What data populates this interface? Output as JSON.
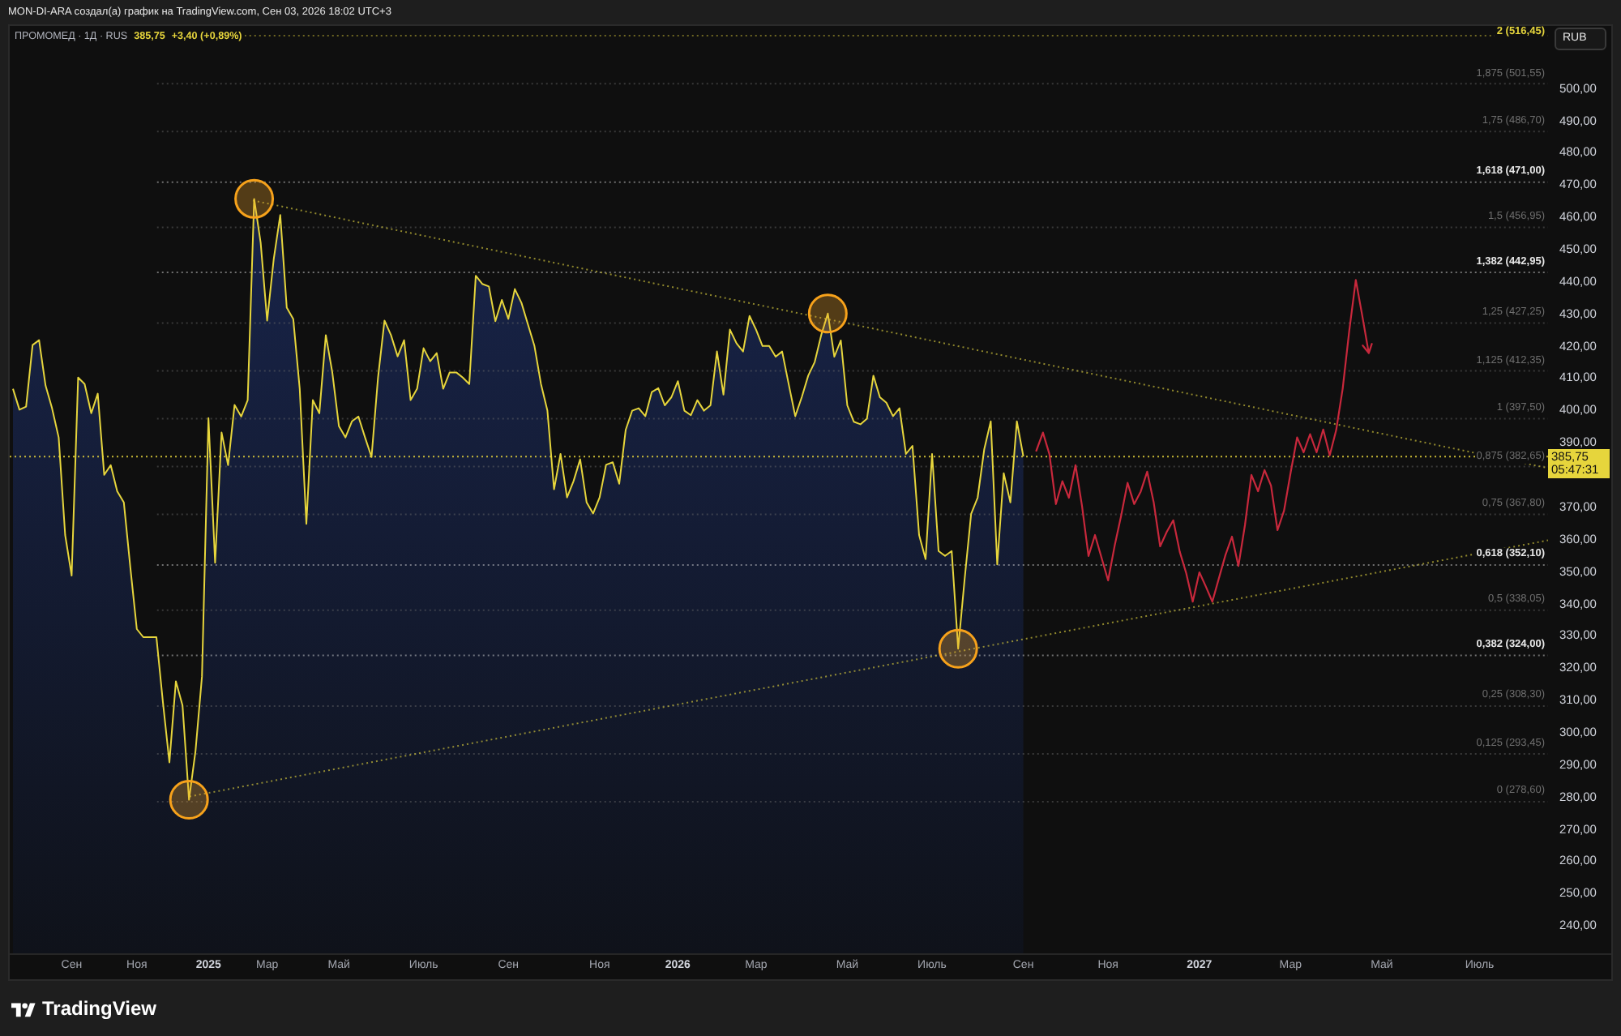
{
  "header": {
    "caption": "MON-DI-ARA создал(а) график на TradingView.com, Сен 03, 2026 18:02 UTC+3"
  },
  "chart": {
    "legend": {
      "symbol": "ПРОМОМЕД · 1Д · RUS",
      "price": "385,75",
      "change": "+3,40 (+0,89%)"
    },
    "currency": "RUB",
    "last_price_badge": {
      "price": "385,75",
      "countdown": "05:47:31"
    },
    "chart_data": {
      "type": "area",
      "categories": [
        null,
        null,
        null,
        null,
        null,
        null,
        null,
        null,
        null,
        "Сен",
        null,
        null,
        null,
        null,
        null,
        null,
        null,
        null,
        null,
        "Ноя",
        null,
        null,
        null,
        null,
        null,
        null,
        null,
        null,
        null,
        null,
        "2025",
        null,
        null,
        null,
        null,
        null,
        null,
        null,
        null,
        "Мар",
        null,
        null,
        null,
        null,
        null,
        null,
        null,
        null,
        null,
        null,
        "Май",
        null,
        null,
        null,
        null,
        null,
        null,
        null,
        null,
        null,
        null,
        null,
        null,
        "Июль",
        null,
        null,
        null,
        null,
        null,
        null,
        null,
        null,
        null,
        null,
        null,
        null,
        "Сен",
        null,
        null,
        null,
        null,
        null,
        null,
        null,
        null,
        null,
        null,
        null,
        null,
        null,
        "Ноя",
        null,
        null,
        null,
        null,
        null,
        null,
        null,
        null,
        null,
        null,
        null,
        "2026",
        null,
        null,
        null,
        null,
        null,
        null,
        null,
        null,
        null,
        null,
        null,
        "Мар",
        null,
        null,
        null,
        null,
        null,
        null,
        null,
        null,
        null,
        null,
        null,
        null,
        null,
        "Май",
        null,
        null,
        null,
        null,
        null,
        null,
        null,
        null,
        null,
        null,
        null,
        null,
        "Июль",
        null,
        null,
        null,
        null,
        null,
        null,
        null,
        null,
        null,
        null,
        null,
        null,
        null,
        "Сен",
        null,
        null,
        null,
        null,
        null,
        null,
        null,
        null,
        null,
        null,
        null,
        null,
        "Ноя",
        null,
        null,
        null,
        null,
        null,
        null,
        null,
        null,
        null,
        null,
        null,
        null,
        null,
        "2027",
        null,
        null,
        null,
        null,
        null,
        null,
        null,
        null,
        null,
        null,
        null,
        null,
        null,
        "Мар",
        null,
        null,
        null,
        null,
        null,
        null,
        null,
        null,
        null,
        null,
        null,
        null,
        null,
        "Май",
        null,
        null,
        null,
        null,
        null,
        null,
        null,
        null,
        null,
        null,
        null,
        null,
        null,
        null,
        "Июль",
        null,
        null,
        null,
        null,
        null,
        null,
        null,
        null,
        null,
        null
      ],
      "series": [
        {
          "color": "#e6d53c",
          "values": [
            406.8,
            400.3,
            401.3,
            420.4,
            421.9,
            407.8,
            400.8,
            391.7,
            361.4,
            348.8,
            410.3,
            408.3,
            399.2,
            405.3,
            380.1,
            383.1,
            375.0,
            371.5,
            351.4,
            332.2,
            329.7,
            329.7,
            329.7,
            309.5,
            290.8,
            316.0,
            308.5,
            279.2,
            294.3,
            317.5,
            397.7,
            352.8,
            393.2,
            383.1,
            401.8,
            398.2,
            403.3,
            465.8,
            452.2,
            428.0,
            447.2,
            460.8,
            432.0,
            428.5,
            406.8,
            364.9,
            403.3,
            399.2,
            423.5,
            411.9,
            395.2,
            391.7,
            396.7,
            398.2,
            391.7,
            385.6,
            410.3,
            428.0,
            423.5,
            416.9,
            421.9,
            403.3,
            406.8,
            419.4,
            415.4,
            417.9,
            406.8,
            411.9,
            411.9,
            410.3,
            408.3,
            441.9,
            439.4,
            438.6,
            427.8,
            434.4,
            428.5,
            437.8,
            433.5,
            426.8,
            420.1,
            408.4,
            400.0,
            375.6,
            386.6,
            373.1,
            378.1,
            384.9,
            371.5,
            368.1,
            373.1,
            383.2,
            384.0,
            377.3,
            394.1,
            400.0,
            400.8,
            398.3,
            405.8,
            407.0,
            401.7,
            404.2,
            409.2,
            400.0,
            398.6,
            403.3,
            400.0,
            401.7,
            418.4,
            405.0,
            425.2,
            420.9,
            418.4,
            429.4,
            425.2,
            420.1,
            420.1,
            416.8,
            418.4,
            408.4,
            398.3,
            404.2,
            410.9,
            415.1,
            423.5,
            430.2,
            416.8,
            421.8,
            401.7,
            396.6,
            395.8,
            397.5,
            410.9,
            404.2,
            402.5,
            398.3,
            400.8,
            386.6,
            389.1,
            361.4,
            353.9,
            386.6,
            356.4,
            354.9,
            356.4,
            326.1,
            347.8,
            368.0,
            373.0,
            388.1,
            396.7,
            352.3,
            380.6,
            371.5,
            396.7,
            385.8,
            null,
            null,
            null,
            null,
            null,
            null,
            null,
            null,
            null,
            null,
            null,
            null,
            null,
            null,
            null,
            null,
            null,
            null,
            null,
            null,
            null,
            null,
            null,
            null,
            null,
            null,
            null,
            null,
            null,
            null,
            null,
            null,
            null,
            null,
            null,
            null,
            null,
            null,
            null,
            null,
            null,
            null,
            null,
            null,
            null,
            null,
            null,
            null,
            null,
            null,
            null,
            null,
            null,
            null,
            null,
            null,
            null,
            null,
            null,
            null,
            null,
            null,
            null,
            null,
            null,
            null,
            null,
            null,
            null,
            null,
            null,
            null,
            null,
            null,
            null,
            null,
            null,
            null,
            null,
            null
          ]
        },
        {
          "type": "line",
          "color": "#c8283c",
          "values": [
            null,
            null,
            null,
            null,
            null,
            null,
            null,
            null,
            null,
            null,
            null,
            null,
            null,
            null,
            null,
            null,
            null,
            null,
            null,
            null,
            null,
            null,
            null,
            null,
            null,
            null,
            null,
            null,
            null,
            null,
            null,
            null,
            null,
            null,
            null,
            null,
            null,
            null,
            null,
            null,
            null,
            null,
            null,
            null,
            null,
            null,
            null,
            null,
            null,
            null,
            null,
            null,
            null,
            null,
            null,
            null,
            null,
            null,
            null,
            null,
            null,
            null,
            null,
            null,
            null,
            null,
            null,
            null,
            null,
            null,
            null,
            null,
            null,
            null,
            null,
            null,
            null,
            null,
            null,
            null,
            null,
            null,
            null,
            null,
            null,
            null,
            null,
            null,
            null,
            null,
            null,
            null,
            null,
            null,
            null,
            null,
            null,
            null,
            null,
            null,
            null,
            null,
            null,
            null,
            null,
            null,
            null,
            null,
            null,
            null,
            null,
            null,
            null,
            null,
            null,
            null,
            null,
            null,
            null,
            null,
            null,
            null,
            null,
            null,
            null,
            null,
            null,
            null,
            null,
            null,
            null,
            null,
            null,
            null,
            null,
            null,
            null,
            null,
            null,
            null,
            null,
            null,
            null,
            null,
            null,
            null,
            null,
            null,
            null,
            null,
            null,
            null,
            null,
            null,
            null,
            null,
            null,
            387.6,
            393.2,
            386.5,
            371.0,
            378.1,
            373.0,
            383.1,
            370.4,
            354.9,
            361.4,
            354.4,
            347.3,
            358.0,
            367.3,
            377.6,
            371.0,
            374.9,
            381.1,
            371.6,
            357.9,
            362.4,
            366.0,
            356.2,
            349.5,
            340.7,
            349.8,
            345.4,
            340.7,
            347.9,
            355.2,
            360.9,
            351.8,
            364.4,
            380.1,
            375.0,
            381.6,
            376.7,
            362.9,
            368.9,
            380.8,
            391.7,
            387.1,
            392.7,
            387.1,
            394.2,
            386.1,
            394.0,
            406.8,
            425.0,
            440.6,
            429.5,
            417.9,
            null,
            null,
            null,
            null,
            null,
            null,
            null,
            null,
            null,
            null,
            null,
            null,
            null,
            null,
            null,
            null,
            null,
            null,
            null,
            null,
            null,
            null,
            null,
            null,
            null,
            null,
            null
          ]
        }
      ],
      "ylim": [
        231.5,
        519.5
      ],
      "yticks": [
        {
          "value": 500,
          "label": "500,00"
        },
        {
          "value": 490,
          "label": "490,00"
        },
        {
          "value": 480,
          "label": "480,00"
        },
        {
          "value": 470,
          "label": "470,00"
        },
        {
          "value": 460,
          "label": "460,00"
        },
        {
          "value": 450,
          "label": "450,00"
        },
        {
          "value": 440,
          "label": "440,00"
        },
        {
          "value": 430,
          "label": "430,00"
        },
        {
          "value": 420,
          "label": "420,00"
        },
        {
          "value": 410,
          "label": "410,00"
        },
        {
          "value": 400,
          "label": "400,00"
        },
        {
          "value": 390,
          "label": "390,00"
        },
        {
          "value": 370,
          "label": "370,00"
        },
        {
          "value": 360,
          "label": "360,00"
        },
        {
          "value": 350,
          "label": "350,00"
        },
        {
          "value": 340,
          "label": "340,00"
        },
        {
          "value": 330,
          "label": "330,00"
        },
        {
          "value": 320,
          "label": "320,00"
        },
        {
          "value": 310,
          "label": "310,00"
        },
        {
          "value": 300,
          "label": "300,00"
        },
        {
          "value": 290,
          "label": "290,00"
        },
        {
          "value": 280,
          "label": "280,00"
        },
        {
          "value": 270,
          "label": "270,00"
        },
        {
          "value": 260,
          "label": "260,00"
        },
        {
          "value": 250,
          "label": "250,00"
        },
        {
          "value": 240,
          "label": "240,00"
        }
      ],
      "ref_lines": [
        {
          "axis": "y",
          "value": 516.45,
          "label": "2 (516,45)",
          "color": "#e3d33c"
        },
        {
          "axis": "y",
          "value": 501.55,
          "label": "1,875 (501,55)",
          "color": "#6e6e6e"
        },
        {
          "axis": "y",
          "value": 486.7,
          "label": "1,75 (486,70)",
          "color": "#6e6e6e"
        },
        {
          "axis": "y",
          "value": 471.0,
          "label": "1,618 (471,00)",
          "color": "#e8e8e8"
        },
        {
          "axis": "y",
          "value": 456.95,
          "label": "1,5 (456,95)",
          "color": "#6e6e6e"
        },
        {
          "axis": "y",
          "value": 442.95,
          "label": "1,382 (442,95)",
          "color": "#e8e8e8"
        },
        {
          "axis": "y",
          "value": 427.25,
          "label": "1,25 (427,25)",
          "color": "#6e6e6e"
        },
        {
          "axis": "y",
          "value": 412.35,
          "label": "1,125 (412,35)",
          "color": "#6e6e6e"
        },
        {
          "axis": "y",
          "value": 397.5,
          "label": "1 (397,50)",
          "color": "#6e6e6e"
        },
        {
          "axis": "y",
          "value": 382.65,
          "label": "0,875 (382,65)",
          "color": "#6e6e6e"
        },
        {
          "axis": "y",
          "value": 367.8,
          "label": "0,75 (367,80)",
          "color": "#6e6e6e"
        },
        {
          "axis": "y",
          "value": 352.1,
          "label": "0,618 (352,10)",
          "color": "#e8e8e8"
        },
        {
          "axis": "y",
          "value": 338.05,
          "label": "0,5 (338,05)",
          "color": "#6e6e6e"
        },
        {
          "axis": "y",
          "value": 324.0,
          "label": "0,382 (324,00)",
          "color": "#e8e8e8"
        },
        {
          "axis": "y",
          "value": 308.3,
          "label": "0,25 (308,30)",
          "color": "#6e6e6e"
        },
        {
          "axis": "y",
          "value": 293.45,
          "label": "0,125 (293,45)",
          "color": "#6e6e6e"
        },
        {
          "axis": "y",
          "value": 278.6,
          "label": "0 (278,60)",
          "color": "#6e6e6e"
        },
        {
          "axis": "y",
          "value": 385.75,
          "color": "#e6d53c"
        }
      ]
    }
  },
  "footer": {
    "brand": "TradingView"
  }
}
